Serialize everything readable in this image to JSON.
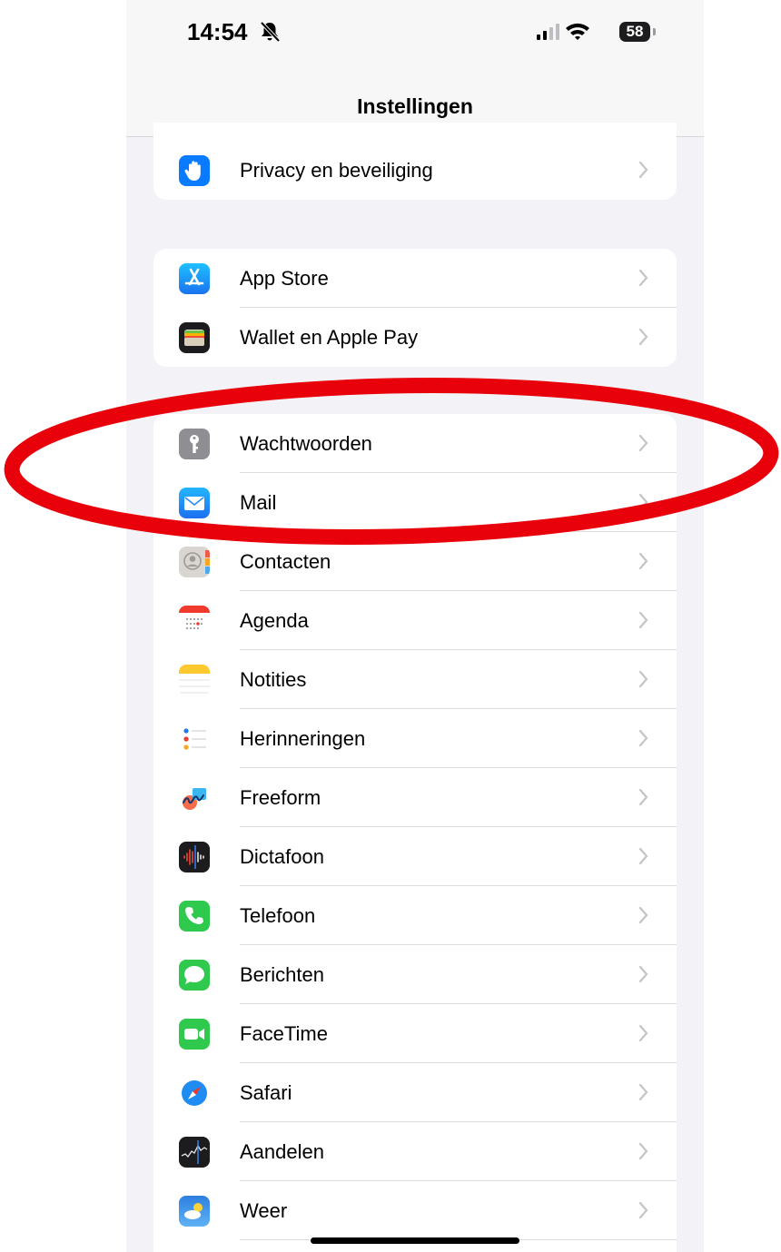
{
  "status_bar": {
    "time": "14:54",
    "battery": "58"
  },
  "nav": {
    "title": "Instellingen"
  },
  "groups": [
    {
      "items": [
        {
          "label": "Privacy en beveiliging",
          "icon": "privacy-hand-icon"
        }
      ]
    },
    {
      "items": [
        {
          "label": "App Store",
          "icon": "app-store-icon"
        },
        {
          "label": "Wallet en Apple Pay",
          "icon": "wallet-icon"
        }
      ]
    },
    {
      "items": [
        {
          "label": "Wachtwoorden",
          "icon": "key-icon"
        },
        {
          "label": "Mail",
          "icon": "mail-icon"
        },
        {
          "label": "Contacten",
          "icon": "contacts-icon"
        },
        {
          "label": "Agenda",
          "icon": "calendar-icon"
        },
        {
          "label": "Notities",
          "icon": "notes-icon"
        },
        {
          "label": "Herinneringen",
          "icon": "reminders-icon"
        },
        {
          "label": "Freeform",
          "icon": "freeform-icon"
        },
        {
          "label": "Dictafoon",
          "icon": "voice-memos-icon"
        },
        {
          "label": "Telefoon",
          "icon": "phone-icon"
        },
        {
          "label": "Berichten",
          "icon": "messages-icon"
        },
        {
          "label": "FaceTime",
          "icon": "facetime-icon"
        },
        {
          "label": "Safari",
          "icon": "safari-icon"
        },
        {
          "label": "Aandelen",
          "icon": "stocks-icon"
        },
        {
          "label": "Weer",
          "icon": "weather-icon"
        }
      ]
    }
  ],
  "annotation": {
    "color": "#e8000b",
    "highlighted": [
      "Wachtwoorden",
      "Mail"
    ]
  }
}
